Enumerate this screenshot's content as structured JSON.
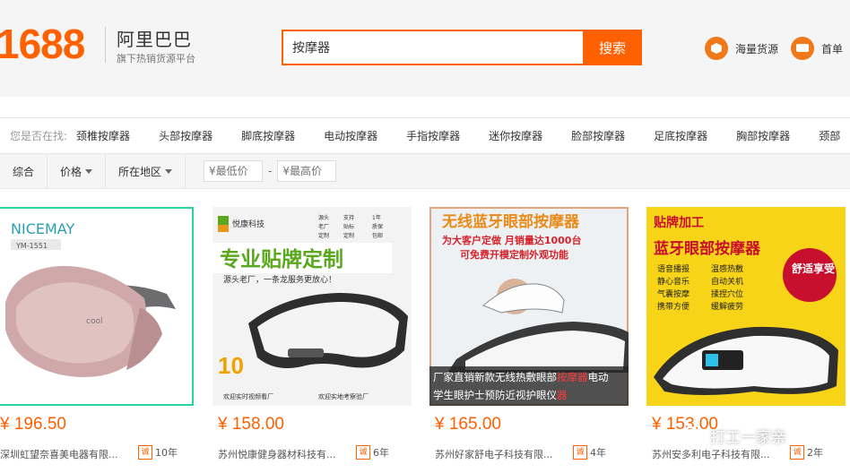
{
  "header": {
    "logo_number": "1688",
    "logo_title": "阿里巴巴",
    "logo_subtitle": "旗下热销货源平台",
    "search_value": "按摩器",
    "search_button": "搜索",
    "links": [
      {
        "label": "海量货源",
        "icon": "box-icon"
      },
      {
        "label": "首单",
        "icon": "truck-icon"
      }
    ]
  },
  "suggest": {
    "label": "您是否在找:",
    "items": [
      "颈椎按摩器",
      "头部按摩器",
      "脚底按摩器",
      "电动按摩器",
      "手指按摩器",
      "迷你按摩器",
      "脸部按摩器",
      "足底按摩器",
      "胸部按摩器",
      "颈部"
    ]
  },
  "filters": {
    "sort_default": "综合",
    "price": "价格",
    "region": "所在地区",
    "min_placeholder": "¥最低价",
    "max_placeholder": "¥最高价",
    "dash": "-"
  },
  "products": [
    {
      "price": "¥ 196.50",
      "company": "深圳虹望奈喜美电器有限...",
      "badge": "诚",
      "years": "10年",
      "brand": "NICEMAY",
      "model": "YM-1551",
      "device_label": "cool"
    },
    {
      "price": "¥ 158.00",
      "company": "苏州悦康健身器材科技有...",
      "badge": "诚",
      "years": "6年",
      "brand": "悦康科技",
      "headline": "专业贴牌定制",
      "tagline": "源头老厂，一条龙服务更放心！",
      "promo_number": "10",
      "features": [
        "源头",
        "支持",
        "1年",
        "老厂",
        "贴标",
        "质保",
        "定制",
        "定制",
        "包邮"
      ],
      "footer_left": "欢迎实时视频看厂",
      "footer_right": "欢迎实地考察验厂"
    },
    {
      "price": "¥ 165.00",
      "company": "苏州好家舒电子科技有限...",
      "badge": "诚",
      "years": "4年",
      "headline": "无线蓝牙眼部按摩器",
      "line2": "为大客户定做 月销量达1000台",
      "line3": "可免费开模定制外观功能",
      "title_a": "厂家直销新款无线热敷眼部",
      "title_hl": "按摩器",
      "title_b": "电动",
      "title_line2a": "学生眼护士预防近视护眼仪",
      "title_line2hl": "器"
    },
    {
      "price": "¥ 153.00",
      "company": "苏州安多利电子科技有限...",
      "badge": "诚",
      "years": "2年",
      "tag": "贴牌加工",
      "headline": "蓝牙眼部按摩器",
      "features": [
        "语音播报",
        "温感热敷",
        "静心音乐",
        "自动关机",
        "气囊按摩",
        "揉捏穴位",
        "携带方便",
        "缓解疲劳"
      ],
      "stamp": "舒适享受"
    }
  ],
  "watermark": "打工一家亲",
  "colors": {
    "brand": "#ff6000",
    "accent_green": "#5aa81e"
  }
}
